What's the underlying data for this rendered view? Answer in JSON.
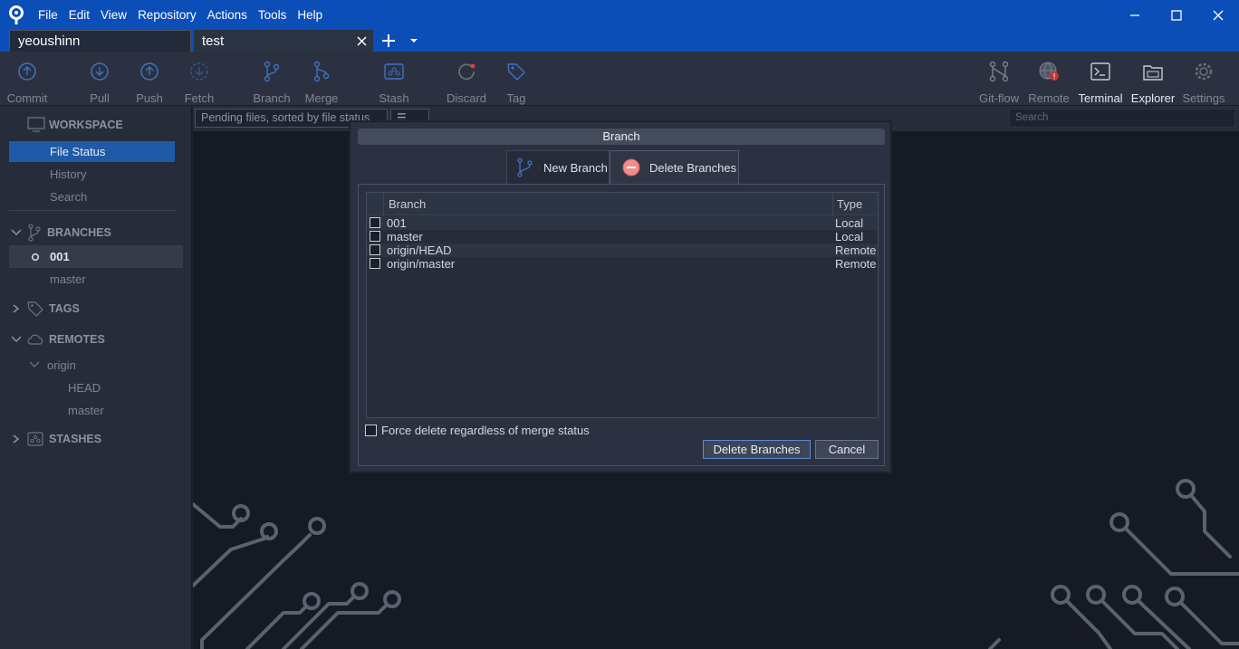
{
  "menu": [
    "File",
    "Edit",
    "View",
    "Repository",
    "Actions",
    "Tools",
    "Help"
  ],
  "tabs": {
    "first": "yeoushinn",
    "second": "test"
  },
  "toolbar": {
    "commit": "Commit",
    "pull": "Pull",
    "push": "Push",
    "fetch": "Fetch",
    "branch": "Branch",
    "merge": "Merge",
    "stash": "Stash",
    "discard": "Discard",
    "tag": "Tag",
    "gitflow": "Git-flow",
    "remote": "Remote",
    "terminal": "Terminal",
    "explorer": "Explorer",
    "settings": "Settings"
  },
  "sidebar": {
    "workspace": "WORKSPACE",
    "file_status": "File Status",
    "history": "History",
    "search": "Search",
    "branches": "BRANCHES",
    "branch_current": "001",
    "branch_master": "master",
    "tags": "TAGS",
    "remotes": "REMOTES",
    "remote_origin": "origin",
    "remote_head": "HEAD",
    "remote_master": "master",
    "stashes": "STASHES"
  },
  "main": {
    "pending_select": "Pending files, sorted by file status",
    "view_select": "☰",
    "search_placeholder": "Search"
  },
  "dialog": {
    "title": "Branch",
    "tab_new": "New Branch",
    "tab_delete": "Delete Branches",
    "col_branch": "Branch",
    "col_type": "Type",
    "rows": [
      {
        "name": "001",
        "type": "Local"
      },
      {
        "name": "master",
        "type": "Local"
      },
      {
        "name": "origin/HEAD",
        "type": "Remote"
      },
      {
        "name": "origin/master",
        "type": "Remote"
      }
    ],
    "force_label": "Force delete regardless of merge status",
    "btn_delete": "Delete Branches",
    "btn_cancel": "Cancel"
  },
  "colors": {
    "titlebar": "#0b4eb8",
    "selection": "#1f5aa8",
    "background": "#161a24",
    "panel": "#2b3140"
  }
}
